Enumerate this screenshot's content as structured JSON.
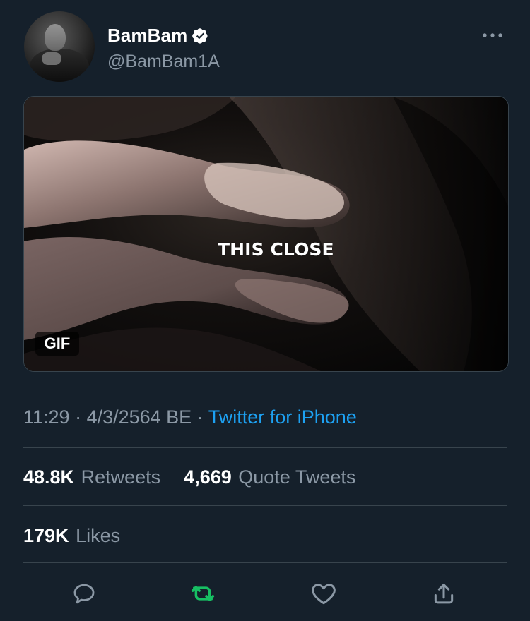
{
  "tweet": {
    "author": {
      "display_name": "BamBam",
      "handle": "@BamBam1A",
      "verified": true,
      "avatar": "avatar"
    },
    "media": {
      "caption": "THIS CLOSE",
      "badge": "GIF"
    },
    "meta": {
      "time": "11:29",
      "separator1": " · ",
      "date": "4/3/2564 BE",
      "separator2": " · ",
      "source": "Twitter for iPhone"
    },
    "stats": {
      "retweets_value": "48.8K",
      "retweets_label": "Retweets",
      "quotes_value": "4,669",
      "quotes_label": "Quote Tweets",
      "likes_value": "179K",
      "likes_label": "Likes"
    },
    "actions": {
      "reply": "reply-icon",
      "retweet": "retweet-icon",
      "like": "heart-icon",
      "share": "share-icon",
      "more": "more-horizontal-icon"
    }
  },
  "colors": {
    "background": "#15202b",
    "primary_text": "#ffffff",
    "secondary_text": "#8b98a5",
    "link": "#1da1f2",
    "divider": "#38444d",
    "retweet_active": "#17bf63"
  }
}
